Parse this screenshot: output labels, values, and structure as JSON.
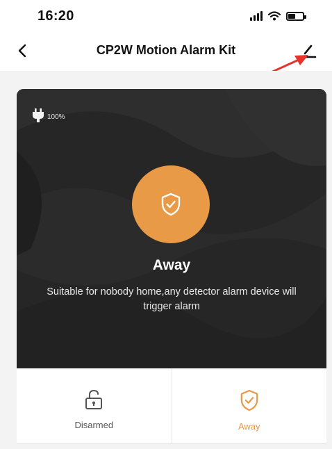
{
  "status_bar": {
    "time": "16:20",
    "icons": [
      "cellular-signal-icon",
      "wifi-icon",
      "battery-icon"
    ]
  },
  "nav": {
    "title": "CP2W Motion Alarm Kit",
    "back_icon": "chevron-left-icon",
    "edit_icon": "pencil-icon"
  },
  "device": {
    "power_icon": "plug-icon",
    "battery_level": "100%"
  },
  "current_mode": {
    "icon": "shield-check-icon",
    "title": "Away",
    "description": "Suitable for nobody home,any detector alarm device will trigger alarm"
  },
  "modes": [
    {
      "label": "Disarmed",
      "icon": "lock-open-icon",
      "active": false
    },
    {
      "label": "Away",
      "icon": "shield-check-icon",
      "active": true
    }
  ],
  "colors": {
    "accent": "#e99a47",
    "card_background": "#262626",
    "annotation_arrow": "#e8332a"
  }
}
